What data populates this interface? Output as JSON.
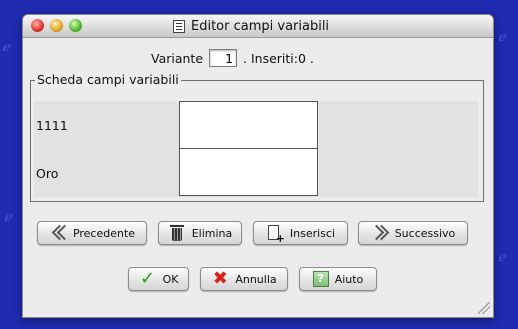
{
  "window": {
    "title": "Editor campi variabili",
    "title_icon": "document-list-icon"
  },
  "variante": {
    "label": "Variante",
    "value": "1",
    "inseriti": ". Inseriti:0 ."
  },
  "panel": {
    "legend": "Scheda campi variabili",
    "rows": [
      {
        "label": "1111",
        "value": ""
      },
      {
        "label": "Oro",
        "value": ""
      }
    ]
  },
  "nav_buttons": {
    "previous": "Precedente",
    "delete": "Elimina",
    "insert": "Inserisci",
    "next": "Successivo"
  },
  "action_buttons": {
    "ok": "OK",
    "cancel": "Annulla",
    "help": "Aiuto"
  },
  "icons": {
    "previous": "double-chevron-left-icon",
    "delete": "trash-icon",
    "insert": "insert-document-icon",
    "next": "double-chevron-right-icon",
    "ok": "checkmark-icon",
    "cancel": "x-icon",
    "help": "help-icon"
  }
}
